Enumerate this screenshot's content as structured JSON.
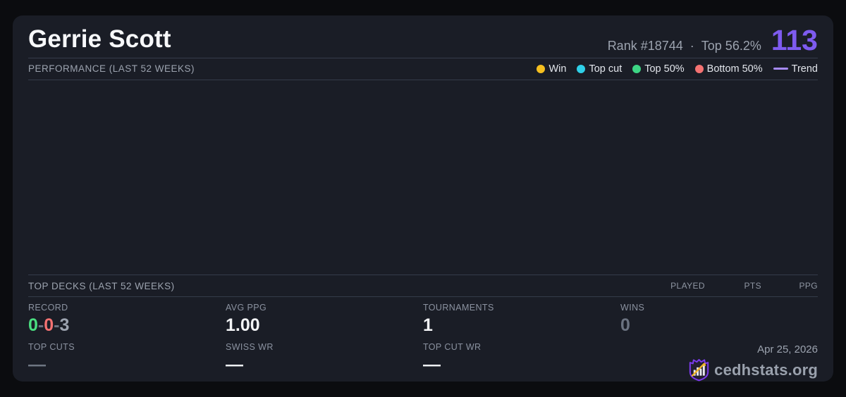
{
  "header": {
    "player_name": "Gerrie Scott",
    "rank": "Rank #18744",
    "dot_separator": "·",
    "top_percent": "Top 56.2%",
    "score": "113"
  },
  "performance": {
    "title": "PERFORMANCE (LAST 52 WEEKS)",
    "legend": [
      {
        "label": "Win",
        "color": "#f5bf1f",
        "marker": "dot"
      },
      {
        "label": "Top cut",
        "color": "#2fd0e8",
        "marker": "dot"
      },
      {
        "label": "Top 50%",
        "color": "#3dd584",
        "marker": "dot"
      },
      {
        "label": "Bottom 50%",
        "color": "#f47272",
        "marker": "dot"
      },
      {
        "label": "Trend",
        "color": "#a78bfa",
        "marker": "line"
      }
    ],
    "chart_empty": true
  },
  "top_decks": {
    "title": "TOP DECKS (LAST 52 WEEKS)",
    "columns": [
      "PLAYED",
      "PTS",
      "PPG"
    ],
    "rows": []
  },
  "stats": {
    "record": {
      "label": "RECORD",
      "wins": "0",
      "losses": "0",
      "draws": "3",
      "separator": "-"
    },
    "avg_ppg": {
      "label": "AVG PPG",
      "value": "1.00"
    },
    "tournaments": {
      "label": "TOURNAMENTS",
      "value": "1"
    },
    "wins": {
      "label": "WINS",
      "value": "0"
    },
    "top_cuts": {
      "label": "TOP CUTS",
      "value": "—"
    },
    "swiss_wr": {
      "label": "SWISS WR",
      "value": "—"
    },
    "top_cut_wr": {
      "label": "TOP CUT WR",
      "value": "—"
    }
  },
  "footer": {
    "date": "Apr 25, 2026",
    "site_name": "cedhstats.org"
  },
  "colors": {
    "page_background": "#0b0c0f",
    "card_background": "#1a1d26",
    "accent_purple": "#7e5bef",
    "trend_purple": "#a78bfa",
    "win_yellow": "#f5bf1f",
    "top_cut_cyan": "#2fd0e8",
    "top50_green": "#3dd584",
    "bottom50_red": "#f47272",
    "record_win_green": "#4ade80",
    "record_loss_red": "#f47272",
    "muted_text": "#9ca3af",
    "divider": "#353c4a",
    "logo_shield_purple": "#7c3aed",
    "logo_arrow_gold": "#f0b429"
  }
}
